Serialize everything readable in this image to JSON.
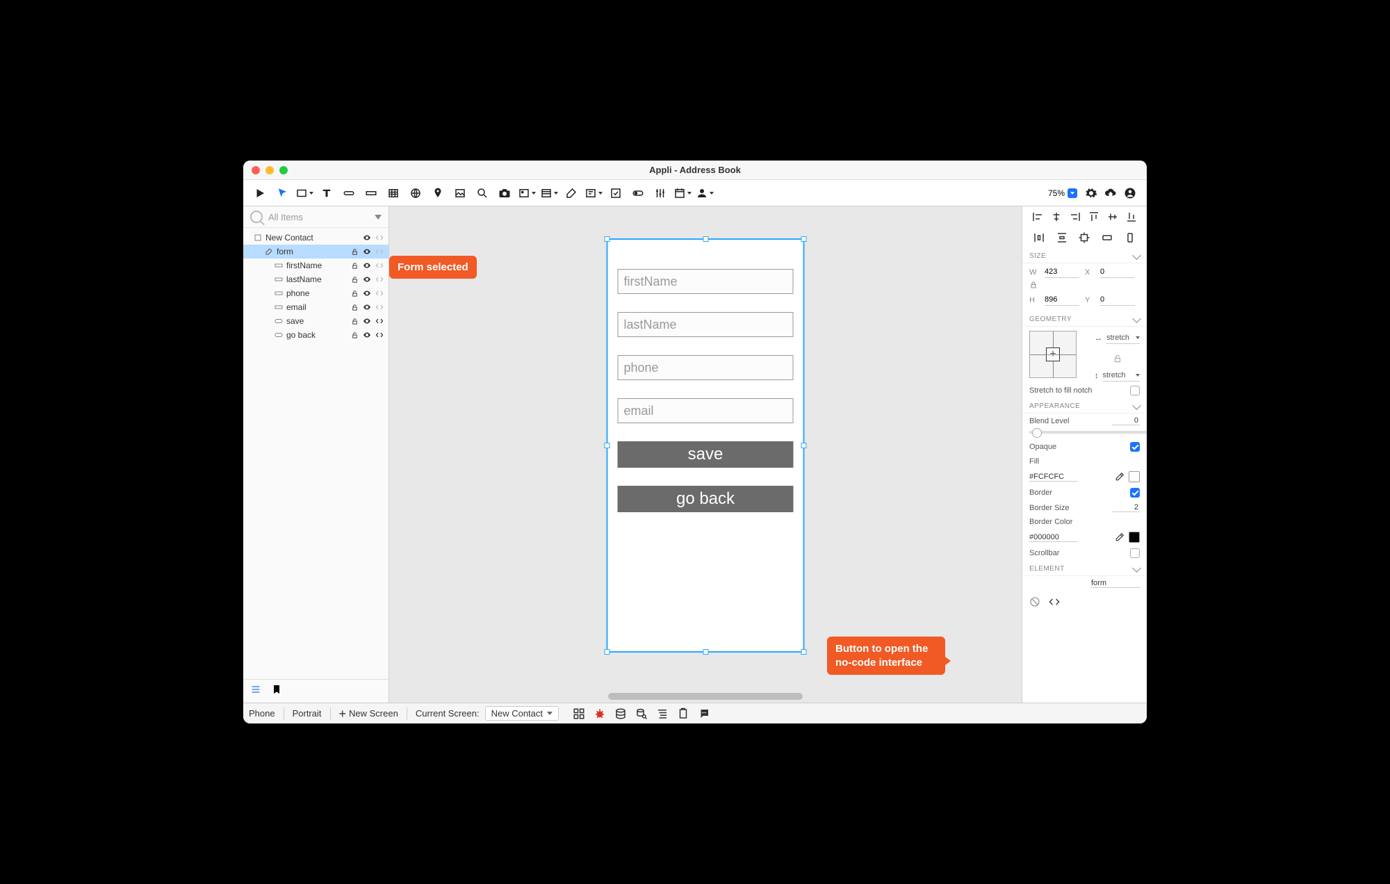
{
  "window": {
    "title": "Appli - Address Book"
  },
  "toolbar": {
    "zoom": "75%"
  },
  "search": {
    "placeholder": "All Items"
  },
  "tree": {
    "items": [
      {
        "label": "New Contact",
        "indent": 14,
        "type": "screen",
        "code_active": false,
        "show_lock": false
      },
      {
        "label": "form",
        "indent": 30,
        "type": "form",
        "selected": true,
        "code_active": false,
        "show_lock": true
      },
      {
        "label": "firstName",
        "indent": 44,
        "type": "field",
        "code_active": false,
        "show_lock": true
      },
      {
        "label": "lastName",
        "indent": 44,
        "type": "field",
        "code_active": false,
        "show_lock": true
      },
      {
        "label": "phone",
        "indent": 44,
        "type": "field",
        "code_active": false,
        "show_lock": true
      },
      {
        "label": "email",
        "indent": 44,
        "type": "field",
        "code_active": false,
        "show_lock": true
      },
      {
        "label": "save",
        "indent": 44,
        "type": "button",
        "code_active": true,
        "show_lock": true
      },
      {
        "label": "go back",
        "indent": 44,
        "type": "button",
        "code_active": true,
        "show_lock": true
      }
    ]
  },
  "callouts": {
    "form_selected": "Form selected",
    "nocode_button": "Button to open the no-code interface"
  },
  "canvas": {
    "fields": {
      "firstName": "firstName",
      "lastName": "lastName",
      "phone": "phone",
      "email": "email"
    },
    "buttons": {
      "save": "save",
      "goBack": "go back"
    }
  },
  "inspector": {
    "sections": {
      "size": "SIZE",
      "geometry": "GEOMETRY",
      "appearance": "APPEARANCE",
      "element": "ELEMENT"
    },
    "size": {
      "w_label": "W",
      "w_value": "423",
      "x_label": "X",
      "x_value": "0",
      "h_label": "H",
      "h_value": "896",
      "y_label": "Y",
      "y_value": "0"
    },
    "geometry": {
      "h_stretch": "stretch",
      "v_stretch": "stretch",
      "fill_notch_label": "Stretch to fill notch",
      "fill_notch": false
    },
    "appearance": {
      "blend_label": "Blend Level",
      "blend_value": "0",
      "opaque_label": "Opaque",
      "opaque": true,
      "fill_label": "Fill",
      "fill_value": "#FCFCFC",
      "border_label": "Border",
      "border": true,
      "border_size_label": "Border Size",
      "border_size": "2",
      "border_color_label": "Border Color",
      "border_color_value": "#000000",
      "scrollbar_label": "Scrollbar",
      "scrollbar": false
    },
    "element": {
      "name_value": "form"
    }
  },
  "status": {
    "device": "Phone",
    "orientation": "Portrait",
    "new_screen": "New Screen",
    "current_label": "Current Screen:",
    "current_value": "New Contact"
  }
}
